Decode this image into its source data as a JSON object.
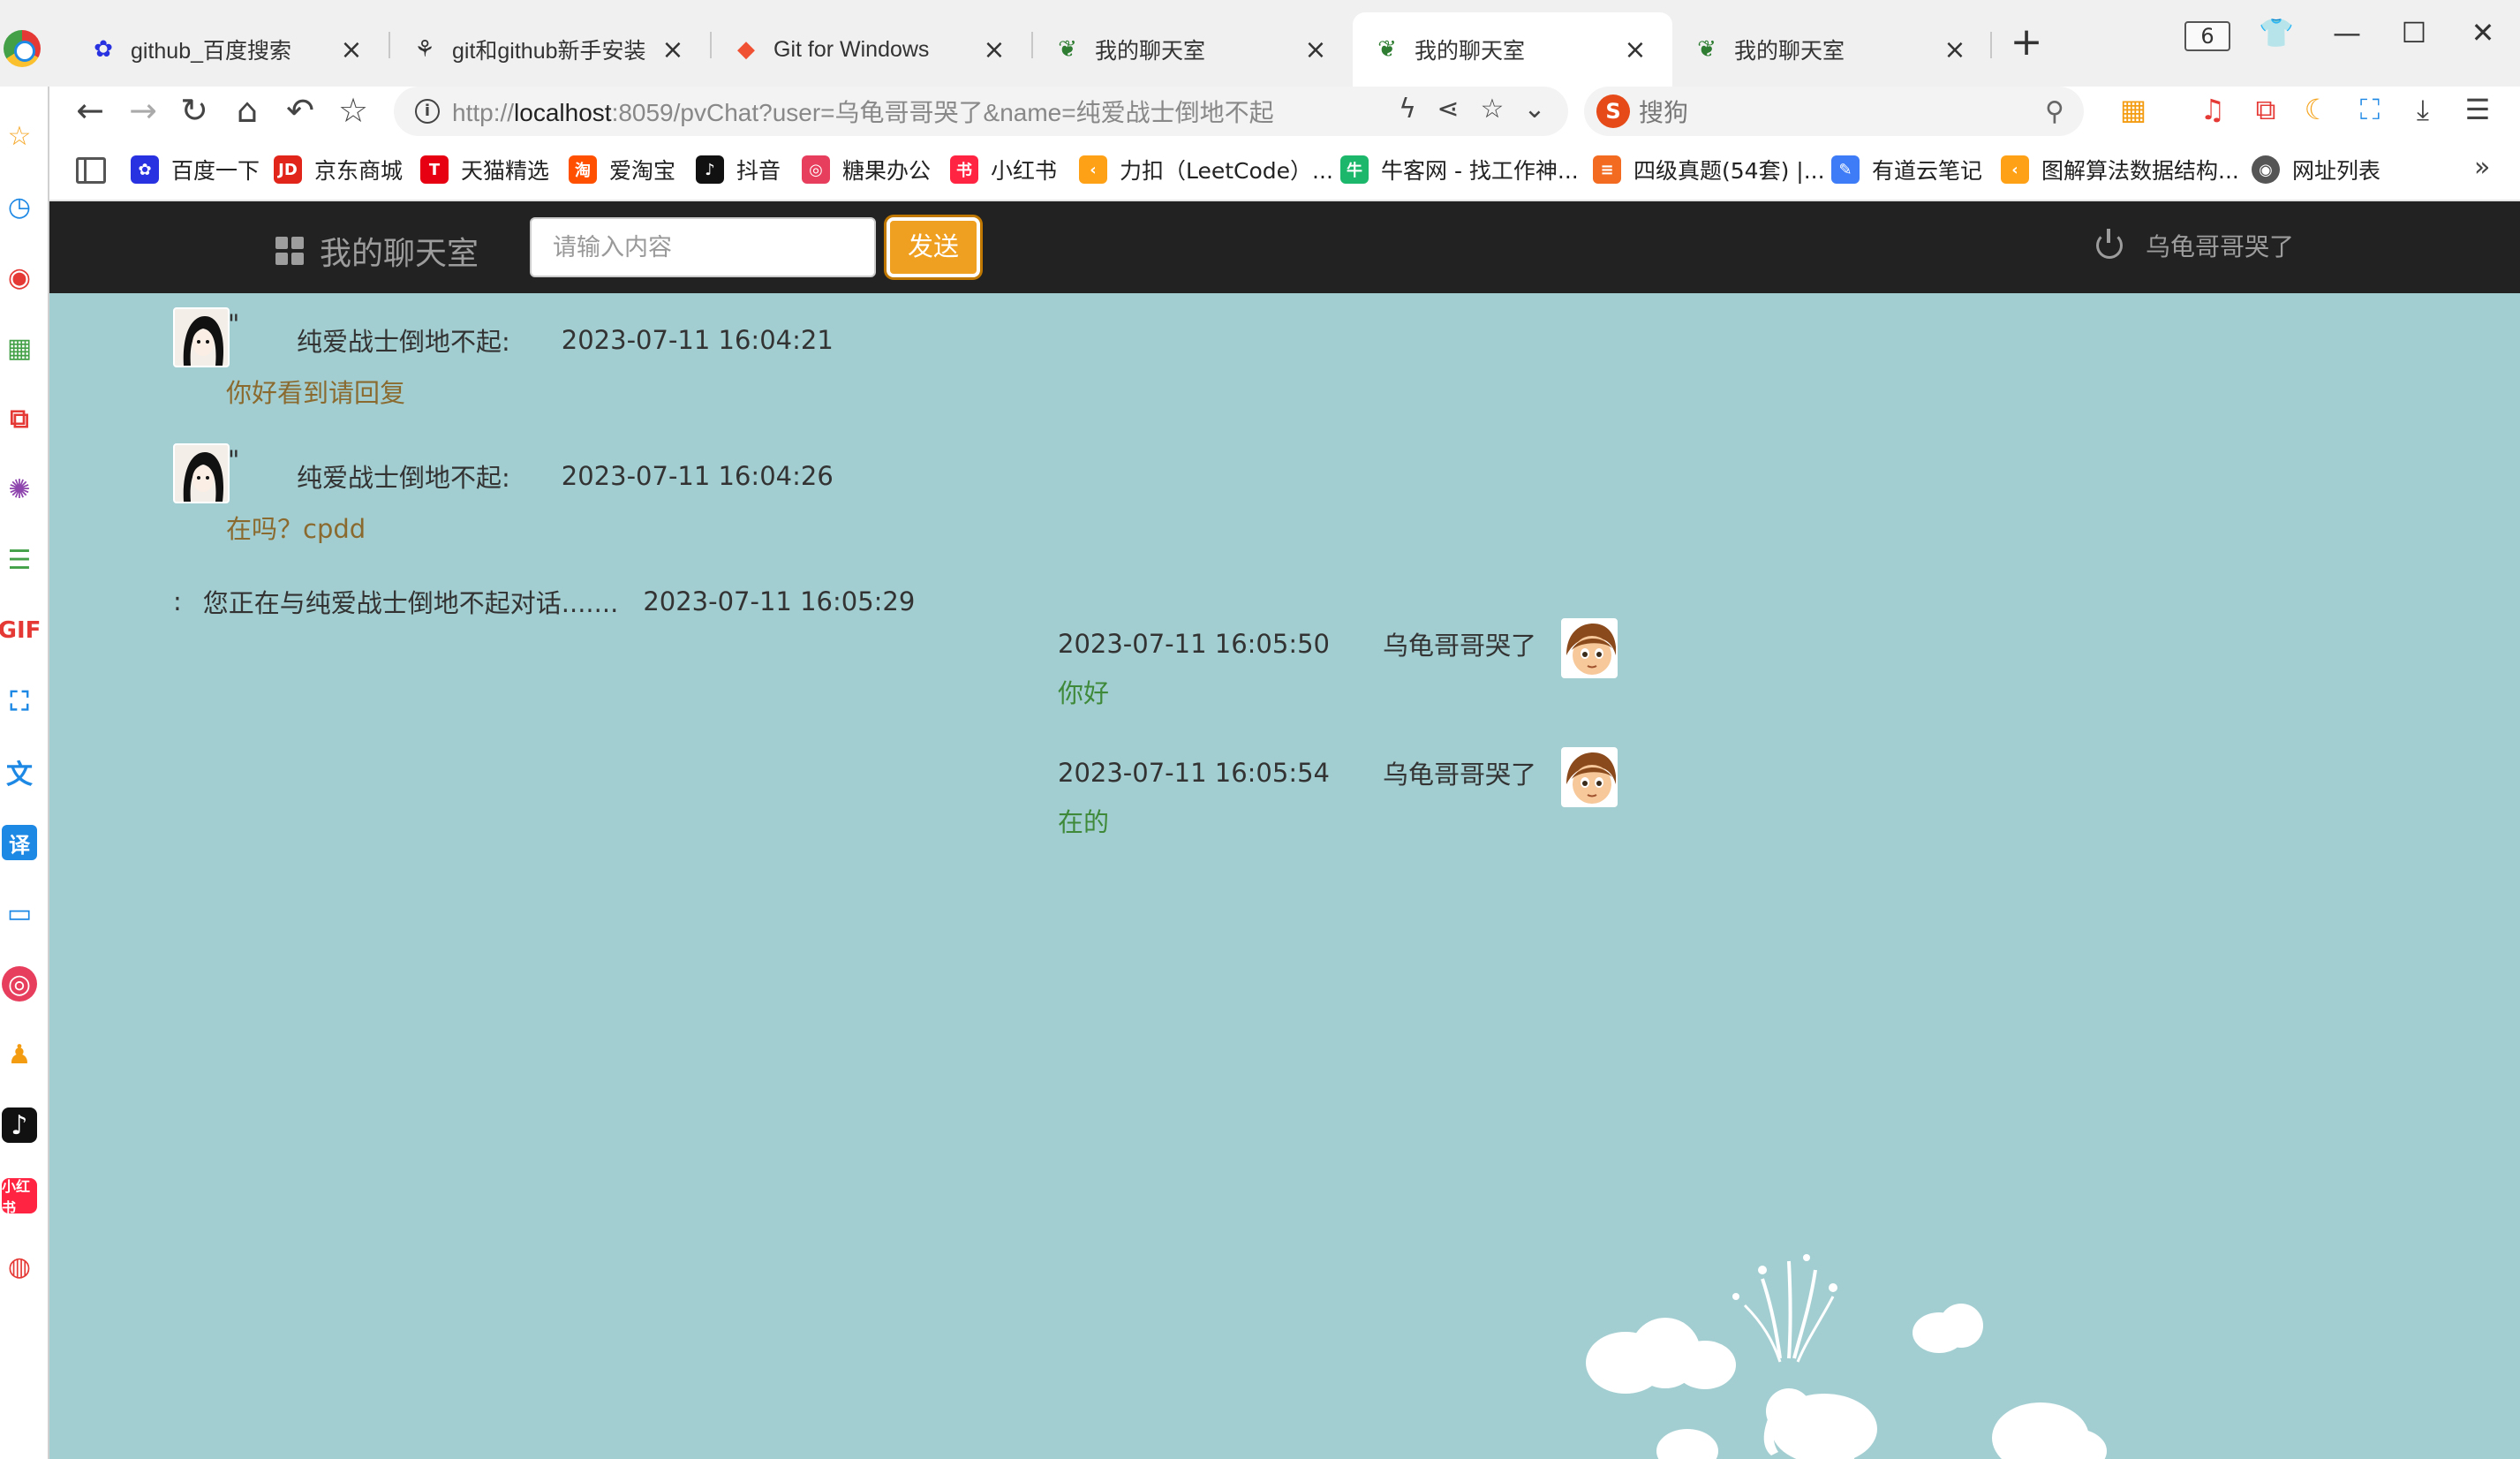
{
  "browser": {
    "tabs": [
      {
        "title": "github_百度搜索",
        "icon": "baidu-paw-icon",
        "active": false
      },
      {
        "title": "git和github新手安装",
        "icon": "github-icon",
        "active": false
      },
      {
        "title": "Git for Windows",
        "icon": "git-icon",
        "active": false
      },
      {
        "title": "我的聊天室",
        "icon": "chat-site-icon",
        "active": false
      },
      {
        "title": "我的聊天室",
        "icon": "chat-site-icon",
        "active": true
      },
      {
        "title": "我的聊天室",
        "icon": "chat-site-icon",
        "active": false
      }
    ],
    "tab_count": "6",
    "url_host": "localhost",
    "url_prefix": "http://",
    "url_rest": ":8059/pvChat?user=乌龟哥哥哭了&name=纯爱战士倒地不起",
    "search_engine": "搜狗",
    "bookmarks": [
      {
        "label": "百度一下",
        "icon_color": "#2932e1",
        "glyph": "✿"
      },
      {
        "label": "京东商城",
        "icon_color": "#e1251b",
        "glyph": "JD"
      },
      {
        "label": "天猫精选",
        "icon_color": "#e60012",
        "glyph": "T"
      },
      {
        "label": "爱淘宝",
        "icon_color": "#ff5000",
        "glyph": "淘"
      },
      {
        "label": "抖音",
        "icon_color": "#111111",
        "glyph": "♪"
      },
      {
        "label": "糖果办公",
        "icon_color": "#e83e5d",
        "glyph": "◎"
      },
      {
        "label": "小红书",
        "icon_color": "#ff2442",
        "glyph": "书"
      },
      {
        "label": "力扣（LeetCode）...",
        "icon_color": "#ffa116",
        "glyph": "‹"
      },
      {
        "label": "牛客网 - 找工作神...",
        "icon_color": "#1cb76b",
        "glyph": "牛"
      },
      {
        "label": "四级真题(54套) |...",
        "icon_color": "#f26b21",
        "glyph": "≡"
      },
      {
        "label": "有道云笔记",
        "icon_color": "#3d7cf6",
        "glyph": "✎"
      },
      {
        "label": "图解算法数据结构...",
        "icon_color": "#ffa116",
        "glyph": "‹"
      },
      {
        "label": "网址列表",
        "icon_color": "#555555",
        "glyph": "◉"
      }
    ]
  },
  "app": {
    "brand": "我的聊天室",
    "input_placeholder": "请输入内容",
    "send_label": "发送",
    "current_user": "乌龟哥哥哭了"
  },
  "messages": [
    {
      "side": "left",
      "sender": "纯爱战士倒地不起:",
      "time": "2023-07-11 16:04:21",
      "text": "你好看到请回复",
      "quote": "\""
    },
    {
      "side": "left",
      "sender": "纯爱战士倒地不起:",
      "time": "2023-07-11 16:04:26",
      "text": "在吗？cpdd",
      "quote": "\""
    },
    {
      "side": "system",
      "prefix": ":",
      "text": "您正在与纯爱战士倒地不起对话.......",
      "time": "2023-07-11 16:05:29"
    },
    {
      "side": "right",
      "sender": "乌龟哥哥哭了",
      "time": "2023-07-11 16:05:50",
      "text": "你好"
    },
    {
      "side": "right",
      "sender": "乌龟哥哥哭了",
      "time": "2023-07-11 16:05:54",
      "text": "在的"
    }
  ]
}
